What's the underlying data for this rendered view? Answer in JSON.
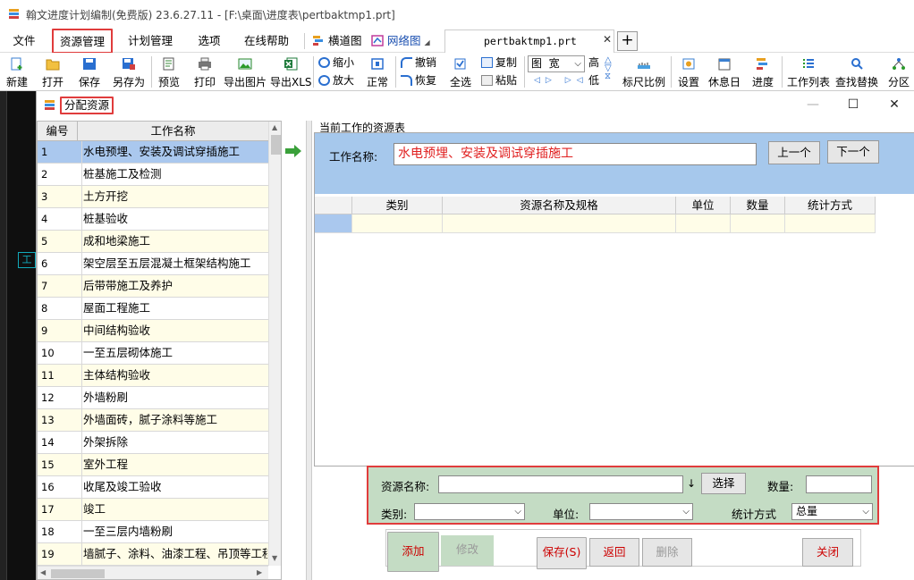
{
  "window": {
    "title": "翰文进度计划编制(免费版) 23.6.27.11 - [F:\\桌面\\进度表\\pertbaktmp1.prt]"
  },
  "menu": {
    "items": [
      "文件",
      "资源管理",
      "计划管理",
      "选项",
      "在线帮助"
    ],
    "view_tabs": [
      "横道图",
      "网络图"
    ],
    "doc_tab": "pertbaktmp1.prt",
    "add_tab": "+"
  },
  "toolbar": {
    "new": "新建",
    "open": "打开",
    "save": "保存",
    "saveas": "另存为",
    "preview": "预览",
    "print": "打印",
    "export_img": "导出图片",
    "export_xls": "导出XLS",
    "zoom_out": "缩小",
    "zoom_in": "放大",
    "normal": "正常",
    "undo": "撤销",
    "redo": "恢复",
    "copy": "复制",
    "paste": "粘贴",
    "select_all": "全选",
    "view_select": "图  宽",
    "high": "高",
    "low": "低",
    "ruler": "标尺比例",
    "settings": "设置",
    "holidays": "休息日",
    "progress": "进度",
    "task_list": "工作列表",
    "find_replace": "查找替换",
    "partition": "分区"
  },
  "dialog": {
    "title": "分配资源",
    "minimize": "—",
    "maximize": "☐",
    "close": "✕",
    "grid_headers": [
      "编号",
      "工作名称"
    ],
    "rows": [
      {
        "n": "1",
        "t": "水电预埋、安装及调试穿插施工",
        "sel": true
      },
      {
        "n": "2",
        "t": "桩基施工及检测"
      },
      {
        "n": "3",
        "t": "土方开挖"
      },
      {
        "n": "4",
        "t": "桩基验收"
      },
      {
        "n": "5",
        "t": "成和地梁施工"
      },
      {
        "n": "6",
        "t": "架空层至五层混凝土框架结构施工"
      },
      {
        "n": "7",
        "t": "后带带施工及养护"
      },
      {
        "n": "8",
        "t": "屋面工程施工"
      },
      {
        "n": "9",
        "t": "中间结构验收"
      },
      {
        "n": "10",
        "t": "一至五层砌体施工"
      },
      {
        "n": "11",
        "t": "主体结构验收"
      },
      {
        "n": "12",
        "t": "外墙粉刷"
      },
      {
        "n": "13",
        "t": "外墙面砖，腻子涂料等施工"
      },
      {
        "n": "14",
        "t": "外架拆除"
      },
      {
        "n": "15",
        "t": "室外工程"
      },
      {
        "n": "16",
        "t": "收尾及竣工验收"
      },
      {
        "n": "17",
        "t": "竣工"
      },
      {
        "n": "18",
        "t": "一至三层内墙粉刷"
      },
      {
        "n": "19",
        "t": "墙腻子、涂料、油漆工程、吊顶等工程"
      }
    ],
    "resource_section": "当前工作的资源表",
    "work_name_label": "工作名称:",
    "work_name_value": "水电预埋、安装及调试穿插施工",
    "prev_button": "上一个",
    "next_button": "下一个",
    "table_headers": [
      "类别",
      "资源名称及规格",
      "单位",
      "数量",
      "统计方式"
    ],
    "form": {
      "res_name_label": "资源名称:",
      "res_name_value": "",
      "select_button": "选择",
      "qty_label": "数量:",
      "qty_value": "",
      "category_label": "类别:",
      "category_value": "",
      "unit_label": "单位:",
      "unit_value": "",
      "stat_label": "统计方式",
      "stat_value": "总量"
    },
    "buttons": {
      "add": "添加",
      "modify": "修改",
      "save": "保存(S)",
      "back": "返回",
      "delete": "删除",
      "close": "关闭"
    }
  },
  "colors": {
    "highlight": "#e03c3c",
    "selection": "#aac8ee",
    "form_bg": "#c4dcc4",
    "work_name_text": "#e02020"
  }
}
